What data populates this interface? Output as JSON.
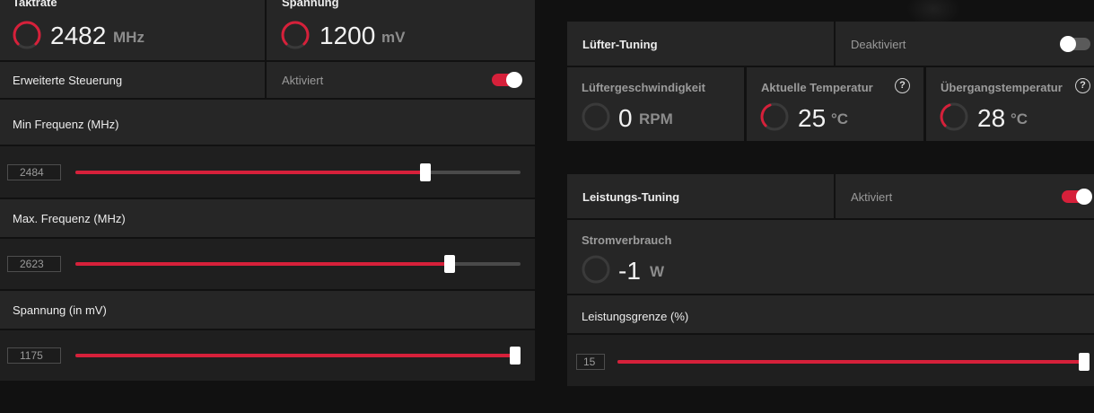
{
  "colors": {
    "accent": "#d6203a",
    "panel": "#262626",
    "background": "#111111"
  },
  "left": {
    "clock": {
      "label": "Taktrate",
      "value": "2482",
      "unit": "MHz"
    },
    "voltage": {
      "label": "Spannung",
      "value": "1200",
      "unit": "mV"
    },
    "advanced": {
      "label": "Erweiterte Steuerung",
      "status": "Aktiviert",
      "enabled": true
    },
    "min_freq": {
      "label": "Min Frequenz (MHz)",
      "value": "2484",
      "level": 0.79
    },
    "max_freq": {
      "label": "Max. Frequenz (MHz)",
      "value": "2623",
      "level": 0.84
    },
    "volt_slider": {
      "label": "Spannung (in mV)",
      "value": "1175",
      "level": 0.99
    }
  },
  "fan": {
    "title": "Lüfter-Tuning",
    "status": "Deaktiviert",
    "enabled": false,
    "speed": {
      "label": "Lüftergeschwindigkeit",
      "value": "0",
      "unit": "RPM"
    },
    "current_temp": {
      "label": "Aktuelle Temperatur",
      "value": "25",
      "unit": "°C",
      "help": "?"
    },
    "junction_temp": {
      "label": "Übergangstemperatur",
      "value": "28",
      "unit": "°C",
      "help": "?"
    }
  },
  "power": {
    "title": "Leistungs-Tuning",
    "status": "Aktiviert",
    "enabled": true,
    "consumption": {
      "label": "Stromverbrauch",
      "value": "-1",
      "unit": "W"
    },
    "limit": {
      "label": "Leistungsgrenze (%)",
      "value": "15",
      "level": 1.0
    }
  },
  "icons": [
    "gauge-icon",
    "help-icon"
  ]
}
